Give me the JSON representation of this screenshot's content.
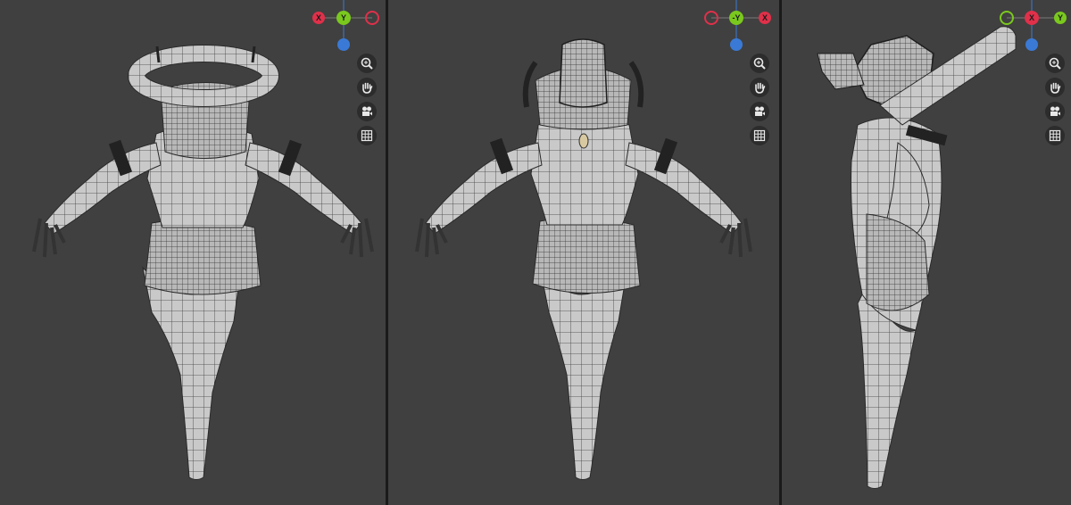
{
  "viewports": [
    {
      "id": "back",
      "gizmo": {
        "left": {
          "label": "X",
          "color": "#e0304a",
          "filled": true
        },
        "center": {
          "label": "Y",
          "color": "#7ac81e",
          "filled": true
        },
        "right": {
          "label": "",
          "color": "#e0304a",
          "filled": false
        },
        "bottom": {
          "color": "#3a7ad6"
        }
      }
    },
    {
      "id": "front",
      "gizmo": {
        "left": {
          "label": "",
          "color": "#e0304a",
          "filled": false
        },
        "center": {
          "label": "-Y",
          "color": "#7ac81e",
          "filled": true
        },
        "right": {
          "label": "X",
          "color": "#e0304a",
          "filled": true
        },
        "bottom": {
          "color": "#3a7ad6"
        }
      }
    },
    {
      "id": "side",
      "gizmo": {
        "left": {
          "label": "",
          "color": "#7ac81e",
          "filled": false
        },
        "center": {
          "label": "X",
          "color": "#e0304a",
          "filled": true
        },
        "right": {
          "label": "Y",
          "color": "#7ac81e",
          "filled": true
        },
        "bottom": {
          "color": "#3a7ad6"
        }
      }
    }
  ],
  "nav_buttons": [
    "zoom-icon",
    "pan-hand-icon",
    "camera-icon",
    "grid-icon"
  ],
  "colors": {
    "viewport_bg": "#404040",
    "divider": "#1a1a1a",
    "mesh": "#c9c9c9",
    "wire": "#3a3a3a",
    "nav_bg": "#2c2c2c",
    "nav_icon": "#e8e8e8"
  }
}
